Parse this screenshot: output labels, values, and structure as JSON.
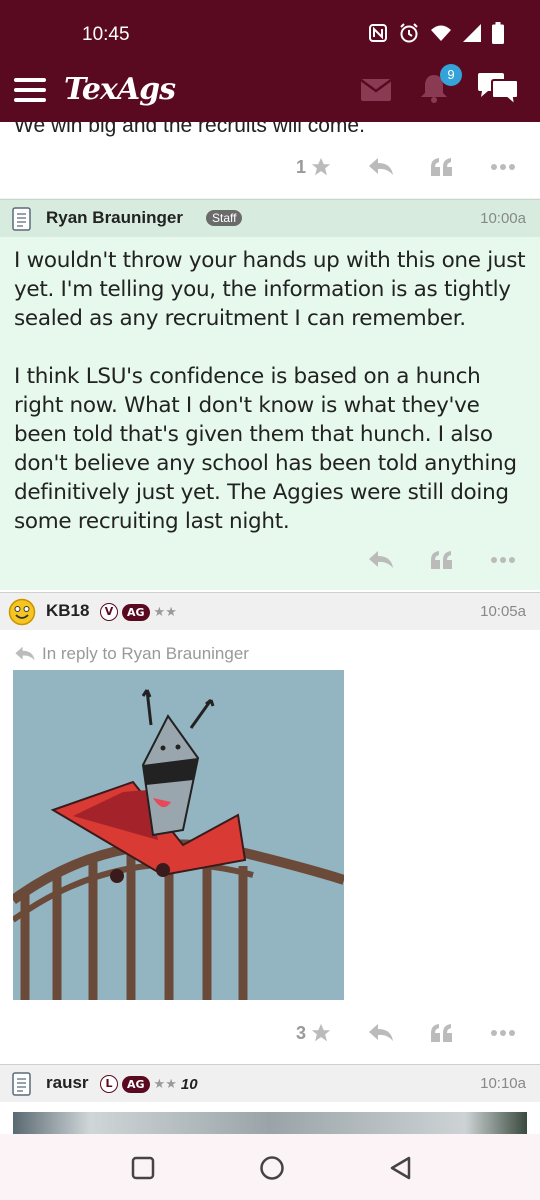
{
  "status": {
    "time": "10:45"
  },
  "app": {
    "logo": "TexAgs",
    "notification_count": "9"
  },
  "previous_post": {
    "text": "We win big and the recruits will come.",
    "likes": "1"
  },
  "posts": [
    {
      "author": "Ryan Brauninger",
      "badge": "Staff",
      "time": "10:00a",
      "paragraphs": [
        "I wouldn't throw your hands up with this one just yet. I'm telling you, the information is as tightly sealed as any recruitment I can remember.",
        "I think LSU's confidence is based on a hunch right now. What I don't know is what they've been told that's given them that hunch. I also don't believe any school has been told anything definitively just yet. The Aggies were still doing some recruiting last night."
      ]
    },
    {
      "author": "KB18",
      "badge_v": "V",
      "badge_ag": "AG",
      "stars": "★★",
      "time": "10:05a",
      "reply_to": "In reply to Ryan Brauninger",
      "likes": "3"
    },
    {
      "author": "rausr",
      "badge_l": "L",
      "badge_ag": "AG",
      "stars": "★★",
      "extra": "10",
      "time": "10:10a"
    }
  ]
}
